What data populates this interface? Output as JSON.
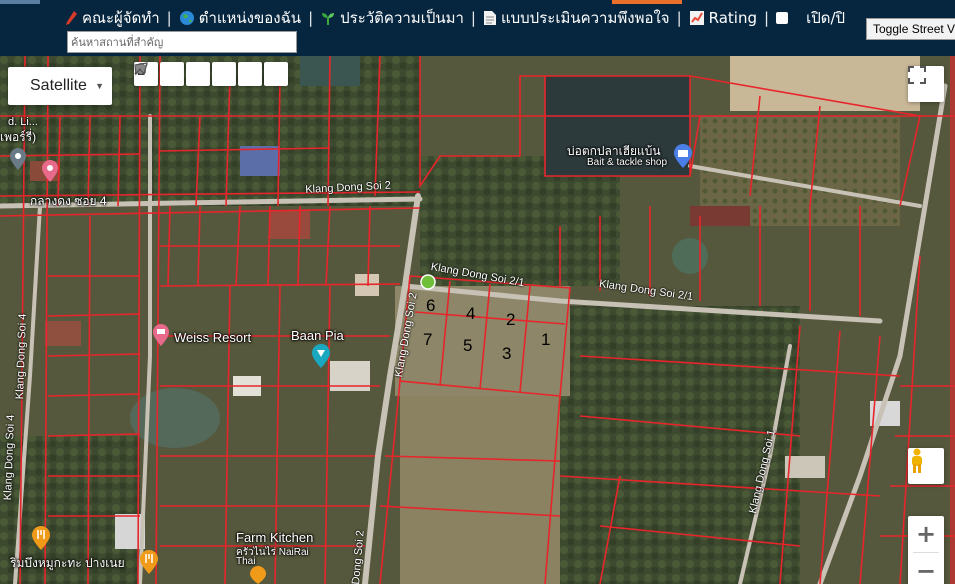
{
  "menu": {
    "items": [
      {
        "label": "คณะผู้จัดทำ",
        "icon": "pen-icon",
        "color": "#d83a2a"
      },
      {
        "label": "ตำแหน่งของฉัน",
        "icon": "globe-icon",
        "color": "#2a8ad8"
      },
      {
        "label": "ประวัติความเป็นมา",
        "icon": "sprout-icon",
        "color": "#3aa83a"
      },
      {
        "label": "แบบประเมินความพึงพอใจ",
        "icon": "document-icon",
        "color": "#e8e8e8"
      },
      {
        "label": "Rating",
        "icon": "chart-icon",
        "color": "#e84a3a"
      },
      {
        "label": "เปิด/ปิ",
        "icon": "checkbox-icon",
        "color": "#ffffff"
      }
    ]
  },
  "search": {
    "placeholder": "ค้นหาสถานที่สำคัญ"
  },
  "street_view_toggle": "Toggle Street V",
  "map": {
    "map_type": "Satellite",
    "places": {
      "weiss_resort": "Weiss Resort",
      "baan_pia": "Baan Pia",
      "bait_shop_th": "บ่อตกปลาเฮียแบ้น",
      "bait_shop_en": "Bait & tackle shop",
      "farm_kitchen": "Farm Kitchen",
      "farm_kitchen_th": "ครัวไนไร่ NaiRai",
      "farm_kitchen_thai": "Thai",
      "rimbueng": "ริมบึงหมูกะทะ ปางเนย",
      "klangdong_soi4_th": "กลางดง ซอย 4",
      "edge_th": "เพอร์รี่)",
      "edge_top": "d. Li..."
    },
    "roads": {
      "soi2": "Klang Dong Soi 2",
      "soi2_1_a": "Klang Dong Soi 2/1",
      "soi2_1_b": "Klang Dong Soi 2/1",
      "soi2_vertical": "Klang Dong Soi 2",
      "soi2_bottom": "Dong Soi 2",
      "soi4_a": "Klang Dong Soi 4",
      "soi4_b": "Klang Dong Soi 4",
      "soi1": "Klang Dong Soi 1"
    },
    "plots": [
      "1",
      "2",
      "3",
      "4",
      "5",
      "6",
      "7"
    ],
    "zoom_in": "+",
    "zoom_out": "−"
  },
  "colors": {
    "topbar": "#06263f",
    "parcel_line": "#e8252b",
    "road": "#c8c2b6"
  }
}
